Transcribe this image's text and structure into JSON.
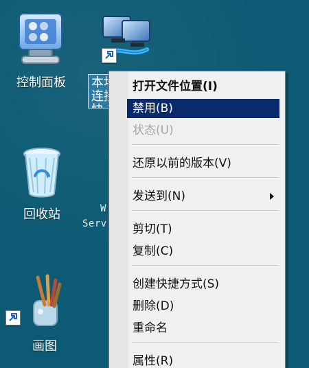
{
  "desktop": {
    "icons": [
      {
        "label": "控制面板",
        "icon": "control-panel-icon"
      },
      {
        "label": "回收站",
        "icon": "recycle-bin-icon"
      },
      {
        "label": "画图",
        "icon": "paint-icon"
      }
    ],
    "selected_icon": {
      "label": "本地连接 快",
      "icon": "network-computer-icon"
    },
    "partially_hidden": {
      "line1": "W",
      "line2": "Serv"
    }
  },
  "context_menu": {
    "items": [
      {
        "label": "打开文件位置(I)",
        "style": "bold"
      },
      {
        "label": "禁用(B)",
        "style": "selected"
      },
      {
        "label": "状态(U)",
        "style": "disabled"
      },
      {
        "label": "还原以前的版本(V)",
        "style": "normal"
      },
      {
        "label": "发送到(N)",
        "style": "submenu"
      },
      {
        "label": "剪切(T)",
        "style": "normal"
      },
      {
        "label": "复制(C)",
        "style": "normal"
      },
      {
        "label": "创建快捷方式(S)",
        "style": "normal"
      },
      {
        "label": "删除(D)",
        "style": "normal"
      },
      {
        "label": "重命名",
        "style": "normal"
      },
      {
        "label": "属性(R)",
        "style": "normal"
      }
    ]
  },
  "colors": {
    "desktop": "#0c5a73",
    "menu_bg": "#f0f0f0",
    "menu_selected": "#0b2a6b",
    "menu_disabled_text": "#a6a6a6"
  }
}
